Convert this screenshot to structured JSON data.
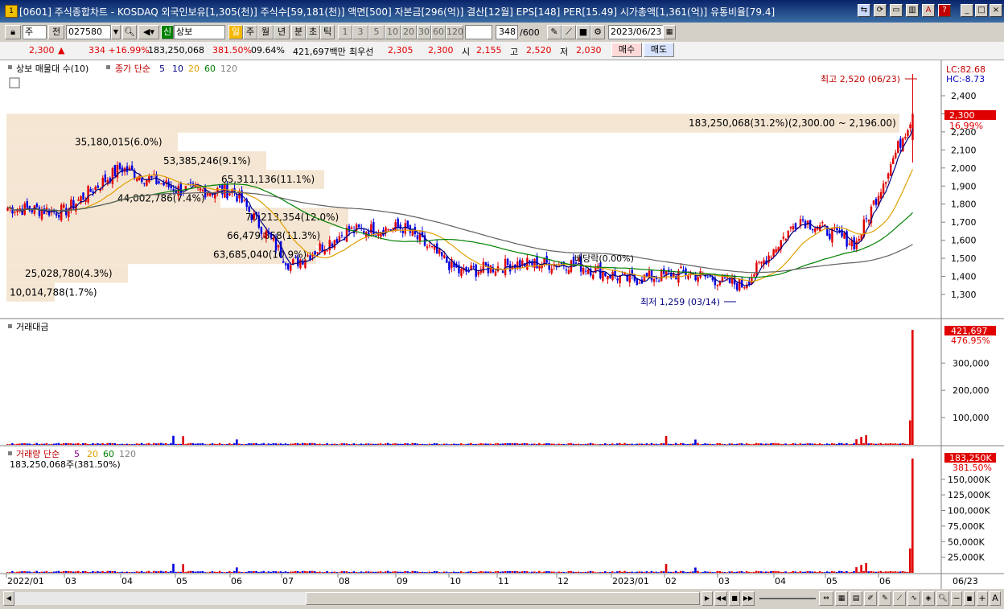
{
  "window": {
    "title": "[0601] 주식종합차트 - KOSDAQ 외국인보유[1,305(천)] 주식수[59,181(천)] 액면[500] 자본금[296(억)] 결산[12월] EPS[148] PER[15.49] 시가총액[1,361(억)] 유통비율[79.4]",
    "icon_label": "1"
  },
  "toolbar": {
    "market_select": "주",
    "prev_label": "전",
    "code": "027580",
    "name_badge": "신",
    "stock_name": "상보",
    "periods": [
      "일",
      "주",
      "월",
      "년",
      "분",
      "초",
      "틱"
    ],
    "intervals": [
      "1",
      "3",
      "5",
      "10",
      "20",
      "30",
      "60",
      "120"
    ],
    "count_value": "348",
    "count_total": "/600",
    "date": "2023/06/23"
  },
  "quote": {
    "price": "2,300",
    "change_arrow": "▲",
    "change": "334 +16.99%",
    "volume": "183,250,068",
    "volume_ratio": "381.50%",
    "turnover": "09.64%",
    "amount": "421,697백만",
    "prior_label": "최우선",
    "ask": "2,305",
    "bid": "2,300",
    "open_label": "시",
    "open": "2,155",
    "high_label": "고",
    "high": "2,520",
    "low_label": "저",
    "low": "2,030",
    "buy_button": "매수",
    "sell_button": "매도"
  },
  "price_panel": {
    "legend_main": "상보 매물대 수(10)",
    "legend_ma_label": "종가 단순",
    "ma_periods": [
      "5",
      "10",
      "20",
      "60",
      "120"
    ],
    "lc_label": "LC:82.68",
    "hc_label": "HC:-8.73",
    "current_price_tag": "2,300",
    "current_pct_tag": "16.99%",
    "high_annotation": "최고 2,520 (06/23)",
    "low_annotation": "최저 1,259 (03/14)",
    "dividend_annotation": "배당락(0.00%)",
    "volume_profile_labels": [
      "183,250,068(31.2%)(2,300.00 ~ 2,196.00)",
      "35,180,015(6.0%)",
      "53,385,246(9.1%)",
      "65,311,136(11.1%)",
      "44,002,786(7.4%)",
      "70,213,354(12.0%)",
      "66,479,858(11.3%)",
      "63,685,040(10.9%)",
      "25,028,780(4.3%)",
      "10,014,788(1.7%)"
    ],
    "y_ticks": [
      "2,400",
      "2,300",
      "2,200",
      "2,100",
      "2,000",
      "1,900",
      "1,800",
      "1,700",
      "1,600",
      "1,500",
      "1,400",
      "1,300"
    ]
  },
  "amount_panel": {
    "title": "거래대금",
    "tag_value": "421,697",
    "tag_pct": "476.95%",
    "y_ticks": [
      "300,000",
      "200,000",
      "100,000"
    ]
  },
  "volume_panel": {
    "legend_label": "거래량 단순",
    "ma_periods": [
      "5",
      "20",
      "60",
      "120"
    ],
    "summary": "183,250,068주(381.50%)",
    "tag_value": "183,250K",
    "tag_pct": "381.50%",
    "y_ticks": [
      "150,000K",
      "125,000K",
      "100,000K",
      "75,000K",
      "50,000K",
      "25,000K"
    ]
  },
  "x_axis": {
    "labels": [
      "2022/01",
      "03",
      "04",
      "05",
      "06",
      "07",
      "08",
      "09",
      "10",
      "11",
      "12",
      "2023/01",
      "02",
      "03",
      "04",
      "05",
      "06"
    ],
    "cursor_label": "06/23"
  },
  "colors": {
    "up": "#e00000",
    "down": "#0000e0",
    "ma5": "#000080",
    "ma10": "#000080",
    "ma20": "#e0a000",
    "ma60": "#008000",
    "ma120": "#606060",
    "profile": "#f5e6d3"
  },
  "chart_data": {
    "type": "candlestick",
    "note_price_range": [
      1259,
      2520
    ],
    "monthly_close_approx": {
      "categories": [
        "2022/01",
        "03",
        "04",
        "05",
        "06",
        "07",
        "08",
        "09",
        "10",
        "11",
        "12",
        "2023/01",
        "02",
        "03",
        "04",
        "05",
        "06"
      ],
      "values": [
        1780,
        1760,
        2000,
        1880,
        1870,
        1460,
        1650,
        1670,
        1420,
        1470,
        1470,
        1380,
        1420,
        1350,
        1720,
        1580,
        2300
      ]
    },
    "last": {
      "open": 2155,
      "high": 2520,
      "low": 2030,
      "close": 2300
    }
  }
}
